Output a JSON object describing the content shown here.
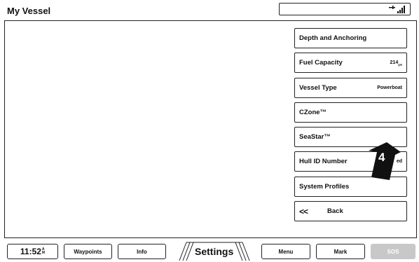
{
  "header": {
    "title": "My Vessel"
  },
  "status": {
    "icon": "signal-strength-icon"
  },
  "menu": {
    "items": [
      {
        "label": "Depth and Anchoring",
        "value": ""
      },
      {
        "label": "Fuel Capacity",
        "value": "214",
        "unit": "gal"
      },
      {
        "label": "Vessel Type",
        "value": "Powerboat"
      },
      {
        "label": "CZone™",
        "value": ""
      },
      {
        "label": "SeaStar™",
        "value": ""
      },
      {
        "label": "Hull ID Number",
        "value": "ed"
      },
      {
        "label": "System Profiles",
        "value": ""
      }
    ],
    "back": {
      "chevron": "<<",
      "label": "Back"
    }
  },
  "callout": {
    "number": "4"
  },
  "bottombar": {
    "clock": {
      "time": "11:52",
      "suffix_top": "A",
      "suffix_bottom": "M"
    },
    "waypoints": "Waypoints",
    "info": "Info",
    "settings": "Settings",
    "menu": "Menu",
    "mark": "Mark",
    "sos": "SOS"
  },
  "colors": {
    "sos_bg": "#c8c8c8",
    "border": "#222222"
  }
}
